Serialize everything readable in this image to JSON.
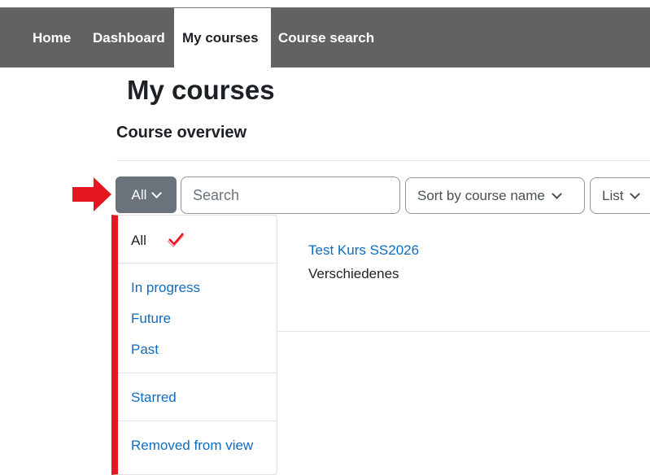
{
  "nav": {
    "items": [
      {
        "label": "Home"
      },
      {
        "label": "Dashboard"
      },
      {
        "label": "My courses",
        "active": true
      },
      {
        "label": "Course search"
      }
    ]
  },
  "page": {
    "title": "My courses",
    "section_title": "Course overview"
  },
  "filters": {
    "grouping_label": "All",
    "search_placeholder": "Search",
    "sort_label": "Sort by course name",
    "view_label": "List"
  },
  "dropdown": {
    "items": [
      {
        "label": "All",
        "selected": true
      },
      {
        "label": "In progress"
      },
      {
        "label": "Future"
      },
      {
        "label": "Past"
      },
      {
        "label": "Starred"
      },
      {
        "label": "Removed from view"
      }
    ]
  },
  "courses": [
    {
      "name": "Test Kurs SS2026",
      "category": "Verschiedenes"
    }
  ],
  "colors": {
    "navbar": "#626262",
    "link": "#0f6cbf",
    "annotation_red": "#e4161e",
    "filter_button": "#6a737b"
  }
}
